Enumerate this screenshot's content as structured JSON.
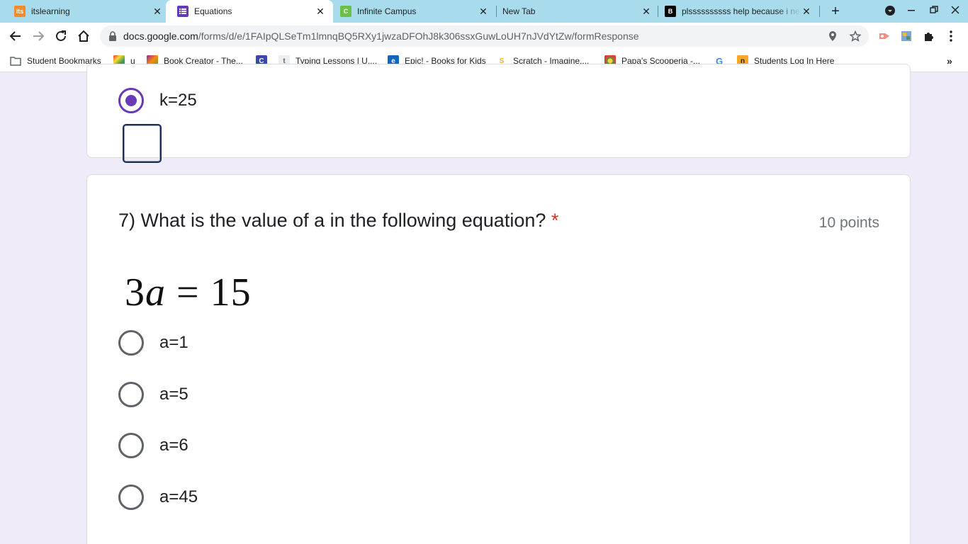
{
  "browser": {
    "tabs": [
      {
        "title": "itslearning",
        "icon": "itslearning-icon",
        "active": false
      },
      {
        "title": "Equations",
        "icon": "google-forms-icon",
        "active": true
      },
      {
        "title": "Infinite Campus",
        "icon": "infinite-campus-icon",
        "active": false
      },
      {
        "title": "New Tab",
        "icon": "",
        "active": false
      },
      {
        "title": "plssssssssss help because i ne",
        "icon": "brainly-icon",
        "active": false
      }
    ],
    "address": {
      "host": "docs.google.com",
      "path": "/forms/d/e/1FAIpQLSeTm1lmnqBQ5RXy1jwzaDFOhJ8k306ssxGuwLoUH7nJVdYtZw/formResponse"
    },
    "bookmarks": [
      {
        "label": "Student Bookmarks",
        "icon": "folder-icon"
      },
      {
        "label": "u",
        "icon": "colorful-app-icon"
      },
      {
        "label": "Book Creator - The...",
        "icon": "book-creator-icon"
      },
      {
        "label": "",
        "icon": "c-app-icon"
      },
      {
        "label": "Typing Lessons | U,...",
        "icon": "typing-icon"
      },
      {
        "label": "Epic! - Books for Kids",
        "icon": "epic-icon"
      },
      {
        "label": "Scratch - Imagine,...",
        "icon": "scratch-icon"
      },
      {
        "label": "Papa's Scooperia -...",
        "icon": "papas-icon"
      },
      {
        "label": "",
        "icon": "google-icon"
      },
      {
        "label": "Students Log In Here",
        "icon": "nearpod-icon"
      }
    ]
  },
  "form": {
    "previous_question": {
      "selected_option": "k=25"
    },
    "question": {
      "title": "7) What is the value of a in the following equation?",
      "required_mark": "*",
      "points": "10 points",
      "equation": {
        "coef": "3",
        "var": "a",
        "rest": " = 15"
      },
      "options": [
        "a=1",
        "a=5",
        "a=6",
        "a=45"
      ]
    }
  },
  "colors": {
    "accent": "#673ab7",
    "page_bg": "#f0ebf8",
    "tab_strip": "#a8dcec",
    "required": "#d93025"
  }
}
